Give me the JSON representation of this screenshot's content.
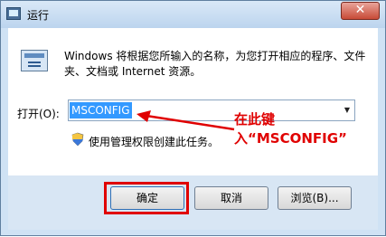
{
  "window": {
    "title": "运行",
    "close_label": "✕"
  },
  "dialog": {
    "description": "Windows 将根据您所输入的名称，为您打开相应的程序、文件夹、文档或 Internet 资源。",
    "open_label": "打开(O):",
    "input_value": "MSCONFIG",
    "admin_text": "使用管理权限创建此任务。"
  },
  "annotation": {
    "text": "在此键入“MSCONFIG”"
  },
  "buttons": {
    "ok": "确定",
    "cancel": "取消",
    "browse": "浏览(B)..."
  },
  "colors": {
    "annotation": "#e00000",
    "selection": "#3399ff"
  }
}
